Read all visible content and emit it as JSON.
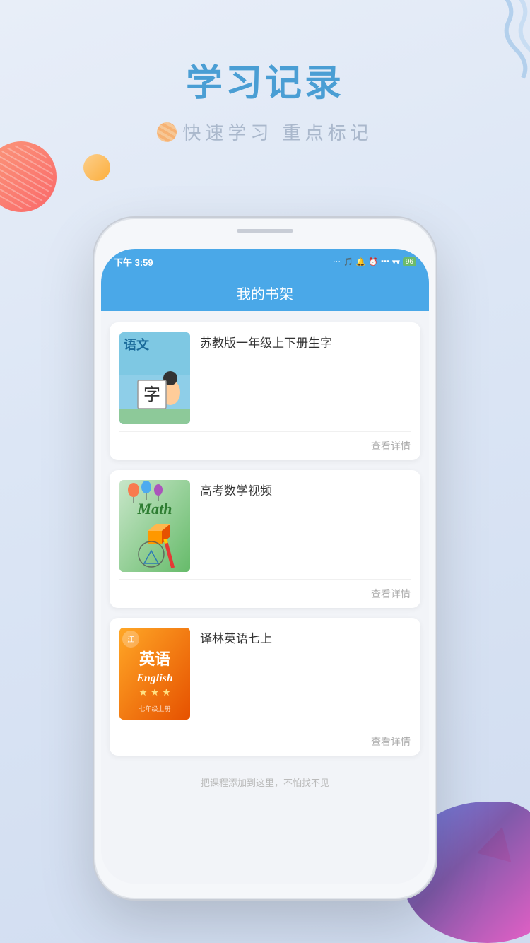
{
  "page": {
    "bg_title": "学习记录",
    "sub_title_text": "快速学习  重点标记"
  },
  "status_bar": {
    "time": "下午 3:59",
    "icons": "... 🎵 🔔 ⏰ .ıll .ıll ♾ 96"
  },
  "app_bar": {
    "title": "我的书架"
  },
  "books": [
    {
      "id": 1,
      "title": "苏教版一年级上下册生字",
      "detail_btn": "查看详情",
      "cover_type": "chinese"
    },
    {
      "id": 2,
      "title": "高考数学视频",
      "detail_btn": "查看详情",
      "cover_type": "math"
    },
    {
      "id": 3,
      "title": "译林英语七上",
      "detail_btn": "查看详情",
      "cover_type": "english"
    }
  ],
  "bottom_hint": "把课程添加到这里，不怕找不见"
}
